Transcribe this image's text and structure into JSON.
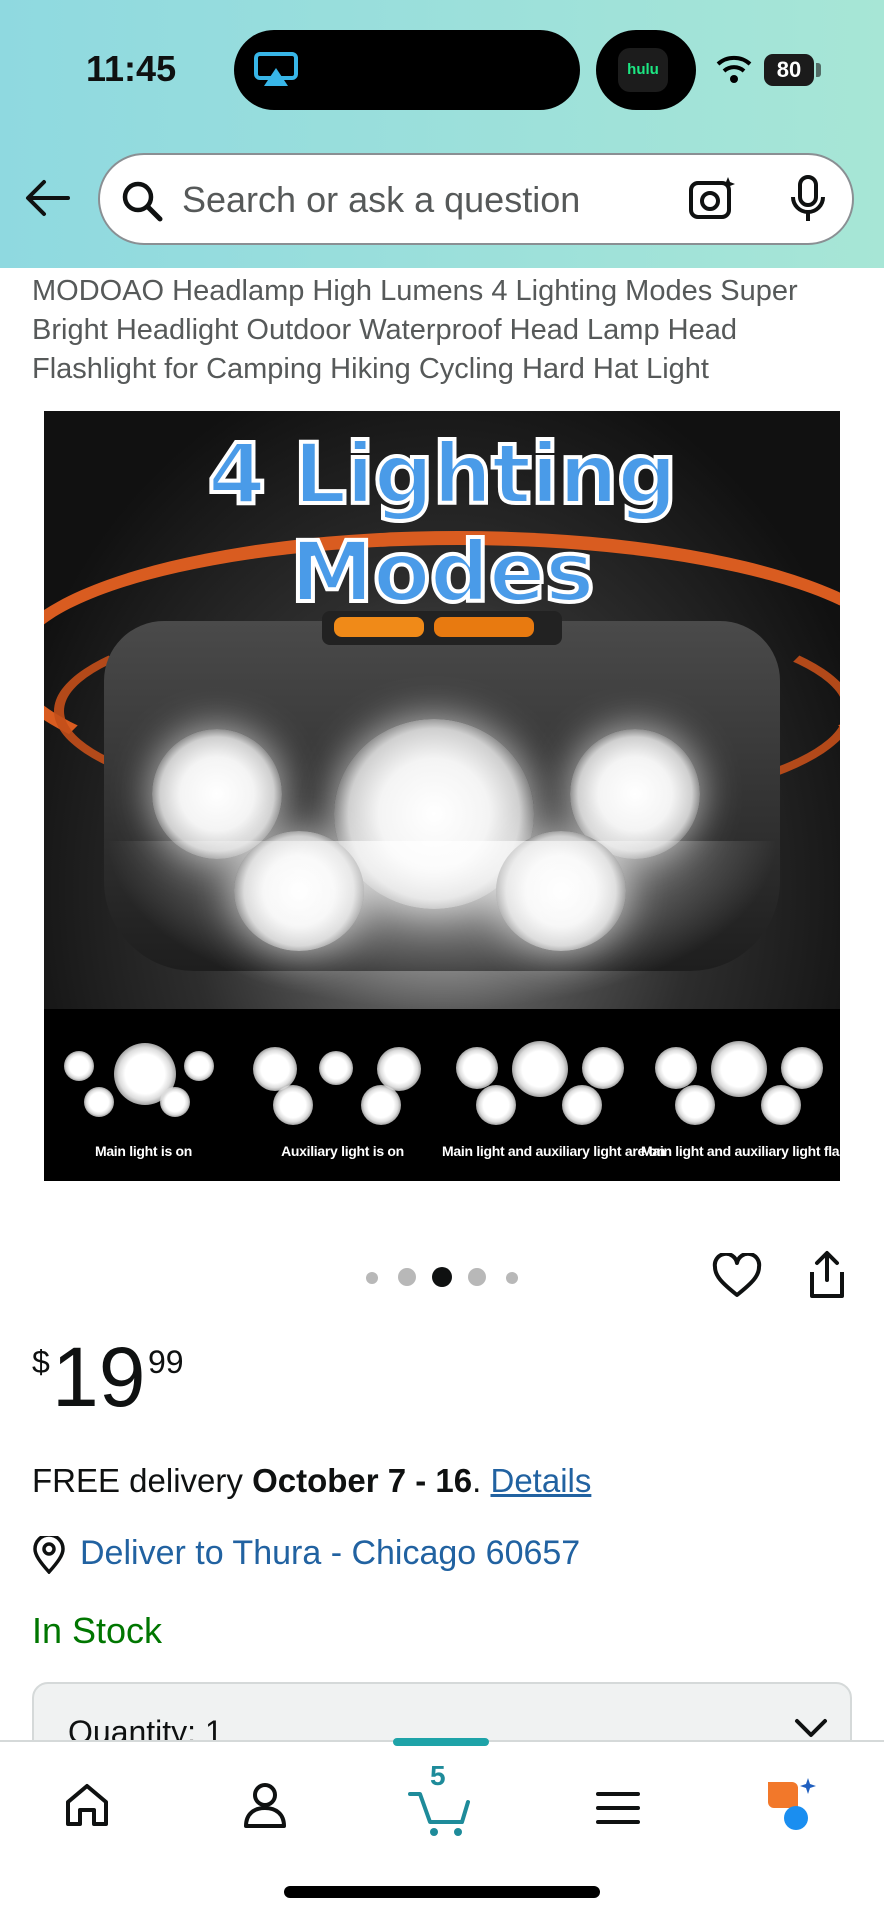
{
  "status_bar": {
    "time": "11:45",
    "live_activity": "hulu",
    "battery": "80"
  },
  "search": {
    "placeholder": "Search or ask a question"
  },
  "product": {
    "title": "MODOAO Headlamp High Lumens 4 Lighting Modes Super Bright Headlight Outdoor Waterproof Head Lamp Head Flashlight for Camping Hiking Cycling Hard Hat Light",
    "image": {
      "headline": "4 Lighting Modes",
      "modes": [
        "Main light is on",
        "Auxiliary light is on",
        "Main light and auxiliary light are on",
        "Main light and auxiliary light flash"
      ]
    },
    "carousel": {
      "count": 5,
      "active_index": 2
    },
    "price": {
      "currency": "$",
      "dollars": "19",
      "cents": "99"
    },
    "delivery": {
      "prefix": "FREE delivery ",
      "dates": "October 7 - 16",
      "suffix": ". ",
      "details_link": "Details"
    },
    "deliver_to": "Deliver to Thura - Chicago 60657",
    "stock": "In Stock",
    "quantity_label": "Quantity: 1"
  },
  "tab_bar": {
    "items": [
      {
        "name": "home",
        "icon": "home-icon"
      },
      {
        "name": "account",
        "icon": "person-icon"
      },
      {
        "name": "cart",
        "icon": "cart-icon"
      },
      {
        "name": "menu",
        "icon": "menu-icon"
      },
      {
        "name": "rufus",
        "icon": "rufus-icon"
      }
    ],
    "cart_count": "5",
    "active": "cart"
  },
  "colors": {
    "header_start": "#8fd9e0",
    "header_end": "#a7e6d6",
    "link": "#2162a1",
    "in_stock": "#007600",
    "tab_accent": "#1ea3a8"
  }
}
